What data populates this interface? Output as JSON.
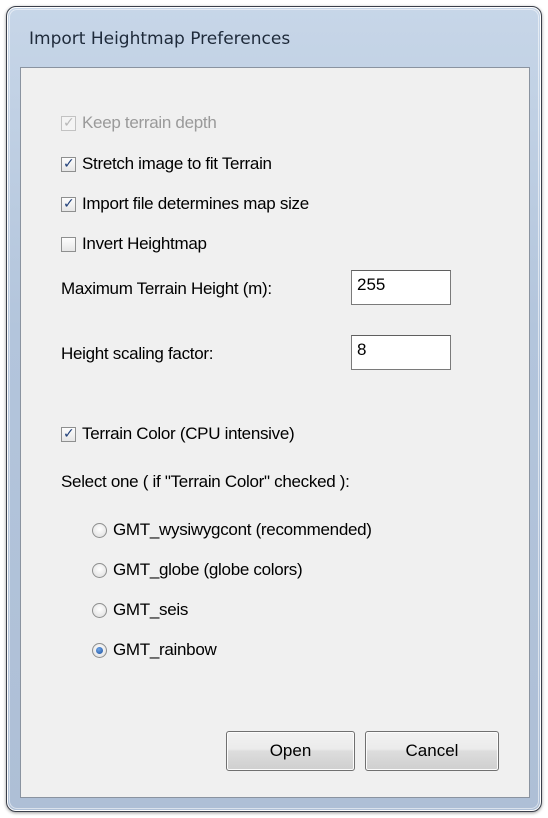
{
  "window": {
    "title": "Import Heightmap Preferences"
  },
  "options": {
    "keep_depth": {
      "label": "Keep terrain depth",
      "checked": true,
      "enabled": false
    },
    "stretch": {
      "label": "Stretch image to fit Terrain",
      "checked": true
    },
    "import_size": {
      "label": "Import file determines map size",
      "checked": true
    },
    "invert": {
      "label": "Invert Heightmap",
      "checked": false
    }
  },
  "fields": {
    "max_height": {
      "label": "Maximum Terrain Height (m):",
      "value": "255"
    },
    "scaling": {
      "label": "Height scaling factor:",
      "value": "8"
    }
  },
  "terrain_color": {
    "label": "Terrain Color (CPU intensive)",
    "checked": true,
    "select_label": "Select one ( if \"Terrain Color\" checked ):",
    "choices": [
      {
        "label": "GMT_wysiwygcont (recommended)",
        "selected": false
      },
      {
        "label": "GMT_globe (globe colors)",
        "selected": false
      },
      {
        "label": "GMT_seis",
        "selected": false
      },
      {
        "label": "GMT_rainbow",
        "selected": true
      }
    ]
  },
  "buttons": {
    "open": "Open",
    "cancel": "Cancel"
  }
}
